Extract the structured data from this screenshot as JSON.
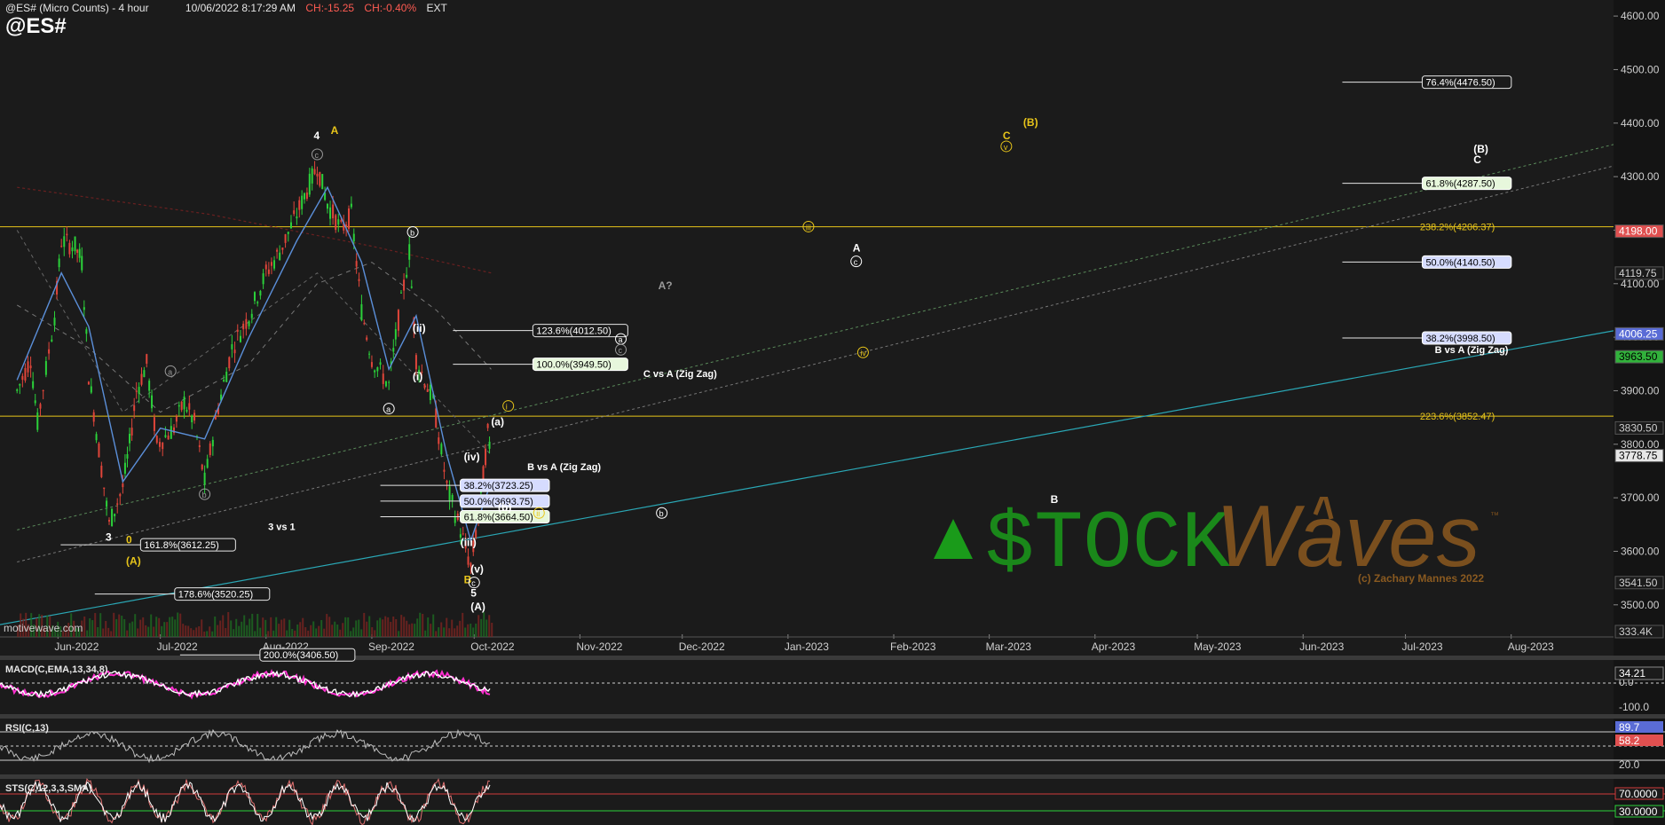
{
  "header": {
    "title": "@ES# (Micro Counts) - 4 hour",
    "datetime": "10/06/2022 8:17:29 AM",
    "change": "CH:-15.25",
    "change_pct": "CH:-0.40%",
    "session": "EXT",
    "symbol": "@ES#"
  },
  "source_label": "motivewave.com",
  "watermark": {
    "brand_part1": "$TOCK",
    "brand_part2": "Waves",
    "tm": "™",
    "copyright": "(c) Zachary Mannes 2022"
  },
  "colors": {
    "bg": "#1b1b1b",
    "axis_bg": "#141414",
    "grid": "#2a2a2a",
    "text": "#e6e6e6",
    "up": "#2bd13a",
    "down": "#e0453a",
    "yellow": "#e8c51a",
    "teal": "#2aa7b5",
    "wm_green": "#1a9b1a",
    "wm_brown": "#7a4f1e",
    "magenta": "#ff2fd0",
    "gray_wave": "#7e7e7e"
  },
  "chart_data": [
    {
      "type": "line",
      "name": "price-pane",
      "y_axis": {
        "ylim": [
          3440,
          4630
        ],
        "ticks": [
          "4600.00",
          "4500.00",
          "4400.00",
          "4300.00",
          "4200.00",
          "4100.00",
          "4000.00",
          "3900.00",
          "3800.00",
          "3700.00",
          "3600.00",
          "3500.00"
        ]
      },
      "x_axis": {
        "categories": [
          "Jun-2022",
          "Jul-2022",
          "Aug-2022",
          "Sep-2022",
          "Oct-2022",
          "Nov-2022",
          "Dec-2022",
          "Jan-2023",
          "Feb-2023",
          "Mar-2023",
          "Apr-2023",
          "May-2023",
          "Jun-2023",
          "Jul-2023",
          "Aug-2023"
        ]
      },
      "price_path": [
        [
          "2022-05-20",
          3900
        ],
        [
          "2022-05-24",
          3960
        ],
        [
          "2022-05-26",
          3840
        ],
        [
          "2022-05-31",
          4040
        ],
        [
          "2022-06-02",
          4180
        ],
        [
          "2022-06-06",
          4170
        ],
        [
          "2022-06-08",
          4140
        ],
        [
          "2022-06-10",
          3930
        ],
        [
          "2022-06-13",
          3790
        ],
        [
          "2022-06-16",
          3650
        ],
        [
          "2022-06-20",
          3720
        ],
        [
          "2022-06-22",
          3800
        ],
        [
          "2022-06-24",
          3900
        ],
        [
          "2022-06-27",
          3950
        ],
        [
          "2022-06-30",
          3800
        ],
        [
          "2022-07-05",
          3830
        ],
        [
          "2022-07-08",
          3880
        ],
        [
          "2022-07-11",
          3840
        ],
        [
          "2022-07-14",
          3730
        ],
        [
          "2022-07-18",
          3870
        ],
        [
          "2022-07-22",
          3980
        ],
        [
          "2022-07-27",
          4040
        ],
        [
          "2022-08-01",
          4120
        ],
        [
          "2022-08-05",
          4160
        ],
        [
          "2022-08-10",
          4230
        ],
        [
          "2022-08-16",
          4320
        ],
        [
          "2022-08-19",
          4250
        ],
        [
          "2022-08-23",
          4200
        ],
        [
          "2022-08-26",
          4230
        ],
        [
          "2022-08-29",
          4050
        ],
        [
          "2022-09-01",
          3960
        ],
        [
          "2022-09-06",
          3910
        ],
        [
          "2022-09-08",
          4000
        ],
        [
          "2022-09-12",
          4160
        ],
        [
          "2022-09-14",
          3960
        ],
        [
          "2022-09-19",
          3880
        ],
        [
          "2022-09-23",
          3720
        ],
        [
          "2022-09-27",
          3640
        ],
        [
          "2022-09-30",
          3570
        ],
        [
          "2022-10-03",
          3700
        ],
        [
          "2022-10-05",
          3820
        ],
        [
          "2022-10-06",
          3780
        ]
      ],
      "ma_fast": [
        [
          "2022-05-20",
          3920
        ],
        [
          "2022-06-02",
          4120
        ],
        [
          "2022-06-10",
          4020
        ],
        [
          "2022-06-20",
          3730
        ],
        [
          "2022-07-01",
          3830
        ],
        [
          "2022-07-14",
          3810
        ],
        [
          "2022-07-27",
          4000
        ],
        [
          "2022-08-10",
          4180
        ],
        [
          "2022-08-19",
          4280
        ],
        [
          "2022-08-29",
          4140
        ],
        [
          "2022-09-06",
          3940
        ],
        [
          "2022-09-14",
          4040
        ],
        [
          "2022-09-23",
          3780
        ],
        [
          "2022-09-30",
          3620
        ],
        [
          "2022-10-06",
          3730
        ]
      ],
      "ma_slow": [
        [
          "2022-05-20",
          4060
        ],
        [
          "2022-06-10",
          3980
        ],
        [
          "2022-07-01",
          3860
        ],
        [
          "2022-07-27",
          3950
        ],
        [
          "2022-08-16",
          4100
        ],
        [
          "2022-09-01",
          4140
        ],
        [
          "2022-09-20",
          4050
        ],
        [
          "2022-10-06",
          3940
        ]
      ],
      "ma_long": [
        [
          "2022-05-20",
          4280
        ],
        [
          "2022-07-15",
          4230
        ],
        [
          "2022-09-01",
          4170
        ],
        [
          "2022-10-06",
          4120
        ]
      ],
      "channel": [
        [
          "2022-05-20",
          4200
        ],
        [
          "2022-06-20",
          3860
        ],
        [
          "2022-08-16",
          4120
        ],
        [
          "2022-09-30",
          3820
        ],
        [
          "2022-10-06",
          3780
        ]
      ],
      "fib_labels": [
        {
          "text": "161.8%(3612.25)",
          "price": 3612.25,
          "date": "2022-07-22",
          "style": "box-white"
        },
        {
          "text": "178.6%(3520.25)",
          "price": 3520.25,
          "date": "2022-08-01",
          "style": "box-white"
        },
        {
          "text": "200.0%(3406.50)",
          "price": 3406.5,
          "date": "2022-08-26",
          "style": "box-white"
        },
        {
          "text": "38.2%(3723.25)",
          "price": 3723.25,
          "date": "2022-10-22",
          "style": "box-blue"
        },
        {
          "text": "50.0%(3693.75)",
          "price": 3693.75,
          "date": "2022-10-22",
          "style": "box-blue"
        },
        {
          "text": "61.8%(3664.50)",
          "price": 3664.5,
          "date": "2022-10-22",
          "style": "box-green"
        },
        {
          "text": "123.6%(4012.50)",
          "price": 4012.5,
          "date": "2022-11-14",
          "style": "box-white"
        },
        {
          "text": "100.0%(3949.50)",
          "price": 3949.5,
          "date": "2022-11-14",
          "style": "box-green"
        },
        {
          "text": "76.4%(4476.50)",
          "price": 4476.5,
          "date": "2023-07-31",
          "style": "box-white"
        },
        {
          "text": "61.8%(4287.50)",
          "price": 4287.5,
          "date": "2023-07-31",
          "style": "box-green"
        },
        {
          "text": "50.0%(4140.50)",
          "price": 4140.5,
          "date": "2023-07-31",
          "style": "box-blue"
        },
        {
          "text": "38.2%(3998.50)",
          "price": 3998.5,
          "date": "2023-07-31",
          "style": "box-blue"
        },
        {
          "text": "238.2%(4206.37)",
          "price": 4206.37,
          "date": "2023-07-31",
          "style": "yellow"
        },
        {
          "text": "223.6%(3852.47)",
          "price": 3852.47,
          "date": "2023-07-31",
          "style": "yellow"
        }
      ],
      "text_labels": [
        {
          "text": "3 vs 1",
          "date": "2022-08-12",
          "price": 3640
        },
        {
          "text": "B vs A (Zig Zag)",
          "date": "2022-10-27",
          "price": 3752
        },
        {
          "text": "C vs A (Zig Zag)",
          "date": "2022-11-30",
          "price": 3926
        },
        {
          "text": "B vs A (Zig Zag)",
          "date": "2023-07-20",
          "price": 3970
        }
      ],
      "wave_labels": [
        {
          "t": "4",
          "d": "2022-08-16",
          "p": 4370,
          "c": "white"
        },
        {
          "t": "A",
          "d": "2022-08-21",
          "p": 4380,
          "c": "yellow"
        },
        {
          "t": "c",
          "d": "2022-08-16",
          "p": 4335,
          "c": "circle-gray"
        },
        {
          "t": "3",
          "d": "2022-06-16",
          "p": 3620,
          "c": "white"
        },
        {
          "t": "0",
          "d": "2022-06-22",
          "p": 3615,
          "c": "yellow"
        },
        {
          "t": "(A)",
          "d": "2022-06-22",
          "p": 3575,
          "c": "yellow"
        },
        {
          "t": "a",
          "d": "2022-07-04",
          "p": 3930,
          "c": "circle-gray"
        },
        {
          "t": "b",
          "d": "2022-07-14",
          "p": 3700,
          "c": "circle-gray"
        },
        {
          "t": "b",
          "d": "2022-09-13",
          "p": 4190,
          "c": "circle-white"
        },
        {
          "t": "a",
          "d": "2022-09-06",
          "p": 3860,
          "c": "circle-white"
        },
        {
          "t": "(ii)",
          "d": "2022-09-14",
          "p": 4010,
          "c": "white"
        },
        {
          "t": "(i)",
          "d": "2022-09-14",
          "p": 3920,
          "c": "white"
        },
        {
          "t": "(iv)",
          "d": "2022-09-29",
          "p": 3770,
          "c": "white"
        },
        {
          "t": "(iii)",
          "d": "2022-09-28",
          "p": 3610,
          "c": "white"
        },
        {
          "t": "(v)",
          "d": "2022-10-01",
          "p": 3560,
          "c": "white"
        },
        {
          "t": "B",
          "d": "2022-09-29",
          "p": 3540,
          "c": "yellow"
        },
        {
          "t": "c",
          "d": "2022-10-01",
          "p": 3535,
          "c": "circle-white"
        },
        {
          "t": "5",
          "d": "2022-10-01",
          "p": 3515,
          "c": "white"
        },
        {
          "t": "(A)",
          "d": "2022-10-01",
          "p": 3490,
          "c": "white"
        },
        {
          "t": "(a)",
          "d": "2022-10-07",
          "p": 3835,
          "c": "white"
        },
        {
          "t": "(b)",
          "d": "2022-10-09",
          "p": 3675,
          "c": "white"
        },
        {
          "t": "i",
          "d": "2022-10-11",
          "p": 3865,
          "c": "circle-yellow"
        },
        {
          "t": "ii",
          "d": "2022-10-20",
          "p": 3665,
          "c": "circle-yellow"
        },
        {
          "t": "b",
          "d": "2022-11-25",
          "p": 3665,
          "c": "circle-white"
        },
        {
          "t": "A?",
          "d": "2022-11-25",
          "p": 4090,
          "c": "gray"
        },
        {
          "t": "a",
          "d": "2022-11-13",
          "p": 3990,
          "c": "circle-white"
        },
        {
          "t": "c",
          "d": "2022-11-13",
          "p": 3970,
          "c": "circle-gray"
        },
        {
          "t": "iii",
          "d": "2023-01-07",
          "p": 4200,
          "c": "circle-yellow"
        },
        {
          "t": "A",
          "d": "2023-01-21",
          "p": 4160,
          "c": "white"
        },
        {
          "t": "c",
          "d": "2023-01-21",
          "p": 4135,
          "c": "circle-white"
        },
        {
          "t": "iv",
          "d": "2023-01-23",
          "p": 3965,
          "c": "circle-yellow"
        },
        {
          "t": "B",
          "d": "2023-03-20",
          "p": 3690,
          "c": "white"
        },
        {
          "t": "(B)",
          "d": "2023-03-12",
          "p": 4395,
          "c": "yellow"
        },
        {
          "t": "C",
          "d": "2023-03-06",
          "p": 4370,
          "c": "yellow"
        },
        {
          "t": "v",
          "d": "2023-03-06",
          "p": 4350,
          "c": "circle-yellow"
        },
        {
          "t": "(B)",
          "d": "2023-07-22",
          "p": 4345,
          "c": "white"
        },
        {
          "t": "C",
          "d": "2023-07-22",
          "p": 4325,
          "c": "white"
        }
      ],
      "right_axis_badges": [
        {
          "text": "4198.00",
          "price": 4198,
          "bg": "#e05050",
          "fg": "#ffffff"
        },
        {
          "text": "4119.75",
          "price": 4119.75,
          "bg": "#1b1b1b",
          "fg": "#cfcfcf"
        },
        {
          "text": "4006.25",
          "price": 4006.25,
          "bg": "#5a6cd6",
          "fg": "#ffffff"
        },
        {
          "text": "3963.50",
          "price": 3963.5,
          "bg": "#31b23b",
          "fg": "#000000"
        },
        {
          "text": "3830.50",
          "price": 3830.5,
          "bg": "#1b1b1b",
          "fg": "#cfcfcf"
        },
        {
          "text": "3778.75",
          "price": 3778.75,
          "bg": "#e6e6e6",
          "fg": "#000000"
        },
        {
          "text": "3541.50",
          "price": 3541.5,
          "bg": "#1b1b1b",
          "fg": "#cfcfcf"
        },
        {
          "text": "333.4K",
          "price": 3450,
          "bg": "#1b1b1b",
          "fg": "#cfcfcf"
        }
      ]
    },
    {
      "type": "line",
      "name": "MACD(C,EMA,13,34,8)",
      "ticks": [
        "0.0",
        "-100.0"
      ],
      "badge": "34.21"
    },
    {
      "type": "line",
      "name": "RSI(C,13)",
      "ticks": [
        "20.0"
      ],
      "badges": [
        "89.7",
        "58.2"
      ]
    },
    {
      "type": "line",
      "name": "STS(C,12,3,3,SMA)",
      "badges": [
        "70.0000",
        "30.0000"
      ]
    }
  ]
}
